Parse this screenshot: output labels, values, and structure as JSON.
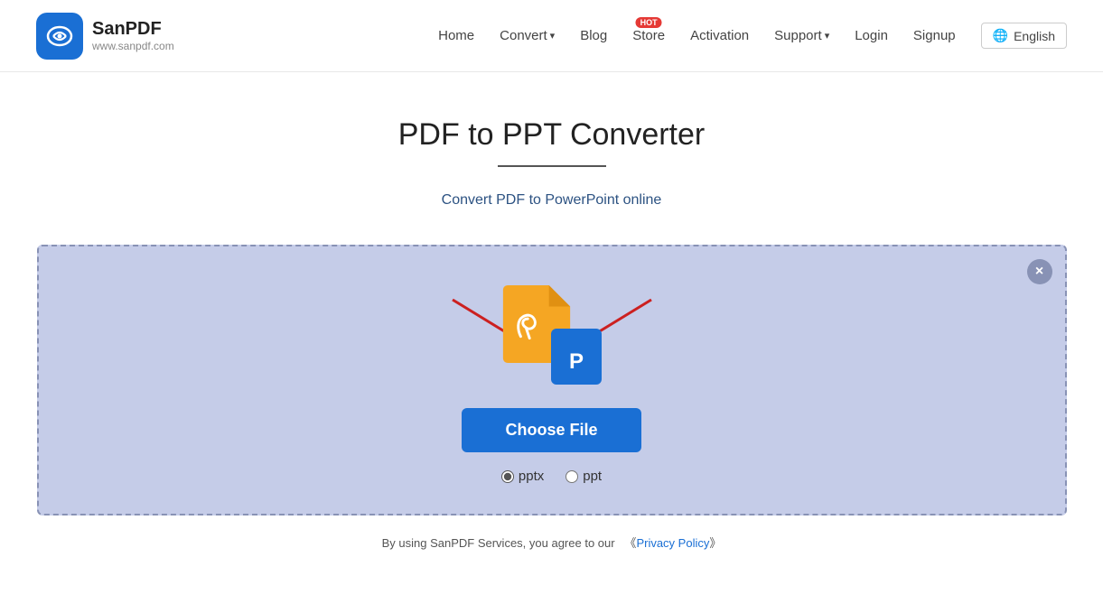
{
  "logo": {
    "title": "SanPDF",
    "url": "www.sanpdf.com"
  },
  "nav": {
    "home": "Home",
    "convert": "Convert",
    "convert_arrow": "▾",
    "blog": "Blog",
    "store": "Store",
    "hot_badge": "HOT",
    "activation": "Activation",
    "support": "Support",
    "support_arrow": "▾",
    "login": "Login",
    "signup": "Signup",
    "lang_icon": "🌐",
    "language": "English"
  },
  "page": {
    "title": "PDF to PPT Converter",
    "subtitle": "Convert PDF to PowerPoint online"
  },
  "dropzone": {
    "choose_file": "Choose File",
    "close_label": "×",
    "format_pptx": "pptx",
    "format_ppt": "ppt"
  },
  "footer": {
    "text_before": "By using SanPDF Services, you agree to our",
    "privacy_policy": "Privacy Policy",
    "bracket_open": "《",
    "bracket_close": "》"
  }
}
